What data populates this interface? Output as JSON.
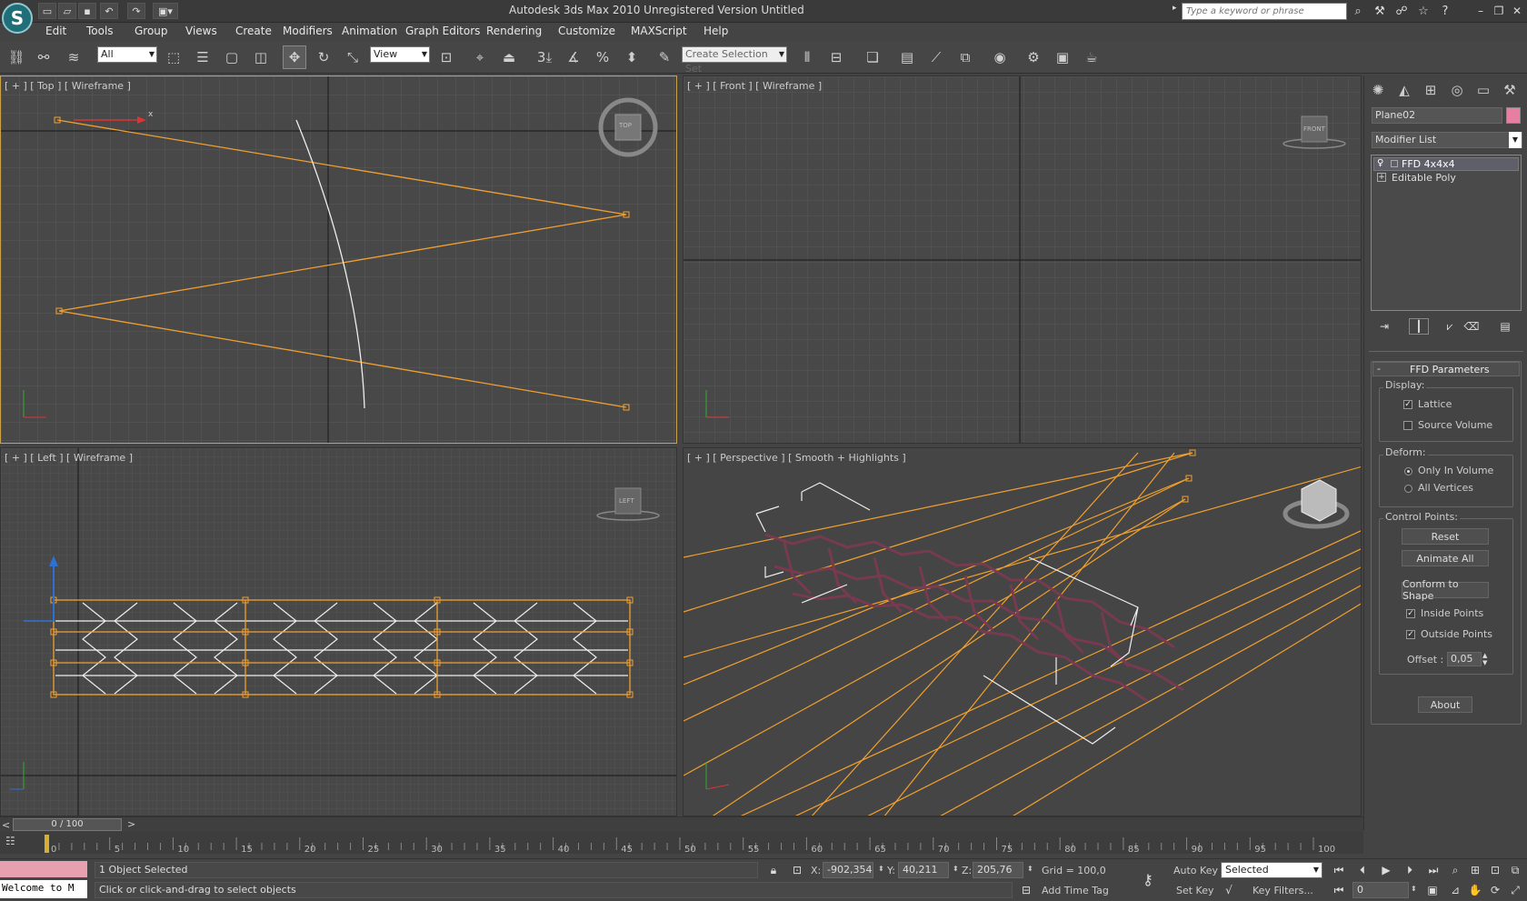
{
  "window": {
    "title": "Autodesk 3ds Max 2010     Unregistered Version     Untitled",
    "logo": "S"
  },
  "quick_access": {
    "icons": [
      "new-icon",
      "open-icon",
      "save-icon",
      "undo-icon",
      "redo-icon",
      "project-icon"
    ]
  },
  "search": {
    "placeholder": "Type a keyword or phrase"
  },
  "menu": {
    "items": [
      "Edit",
      "Tools",
      "Group",
      "Views",
      "Create",
      "Modifiers",
      "Animation",
      "Graph Editors",
      "Rendering",
      "Customize",
      "MAXScript",
      "Help"
    ]
  },
  "toolbar": {
    "filter_value": "All",
    "ref_coord_value": "View",
    "selection_set_placeholder": "Create Selection Set",
    "snap_label": "3"
  },
  "viewports": {
    "top": {
      "label": "[ + ] [ Top ] [ Wireframe ]",
      "cube_label": "TOP"
    },
    "front": {
      "label": "[ + ] [ Front ] [ Wireframe ]",
      "cube_label": "FRONT"
    },
    "left": {
      "label": "[ + ] [ Left ] [ Wireframe ]",
      "cube_label": "LEFT"
    },
    "perspective": {
      "label": "[ + ] [ Perspective ] [ Smooth + Highlights ]"
    }
  },
  "command_panel": {
    "object_name": "Plane02",
    "object_color": "#e87ea0",
    "modifier_list_label": "Modifier List",
    "stack": [
      {
        "label": "FFD 4x4x4",
        "selected": true
      },
      {
        "label": "Editable Poly",
        "selected": false
      }
    ],
    "rollout_title": "FFD Parameters",
    "display": {
      "title": "Display:",
      "lattice": "Lattice",
      "lattice_checked": true,
      "source_volume": "Source Volume",
      "source_volume_checked": false
    },
    "deform": {
      "title": "Deform:",
      "only_in_volume": "Only In Volume",
      "all_vertices": "All Vertices",
      "selected": "Only In Volume"
    },
    "control_points": {
      "title": "Control Points:",
      "reset": "Reset",
      "animate_all": "Animate All",
      "conform": "Conform to Shape",
      "inside_points": "Inside Points",
      "inside_checked": true,
      "outside_points": "Outside Points",
      "outside_checked": true,
      "offset_label": "Offset :",
      "offset_value": "0,05"
    },
    "about": "About"
  },
  "timeline": {
    "frame_label": "0 / 100",
    "prev": "<",
    "next": ">",
    "ticks": [
      "0",
      "5",
      "10",
      "15",
      "20",
      "25",
      "30",
      "35",
      "40",
      "45",
      "50",
      "55",
      "60",
      "65",
      "70",
      "75",
      "80",
      "85",
      "90",
      "95",
      "100"
    ]
  },
  "status": {
    "objects_selected": "1 Object Selected",
    "prompt": "Click or click-and-drag to select objects",
    "maxscript_listener": "Welcome to M",
    "x_label": "X:",
    "x": "-902,354",
    "y_label": "Y:",
    "y": "40,211",
    "z_label": "Z:",
    "z": "205,76",
    "grid": "Grid = 100,0",
    "add_time_tag": "Add Time Tag",
    "auto_key": "Auto Key",
    "set_key": "Set Key",
    "key_mode": "Selected",
    "key_filters": "Key Filters...",
    "current_frame": "0"
  },
  "colors": {
    "accent": "#f0a030",
    "selection": "#ff9900",
    "mesh": "#7a3a50"
  }
}
